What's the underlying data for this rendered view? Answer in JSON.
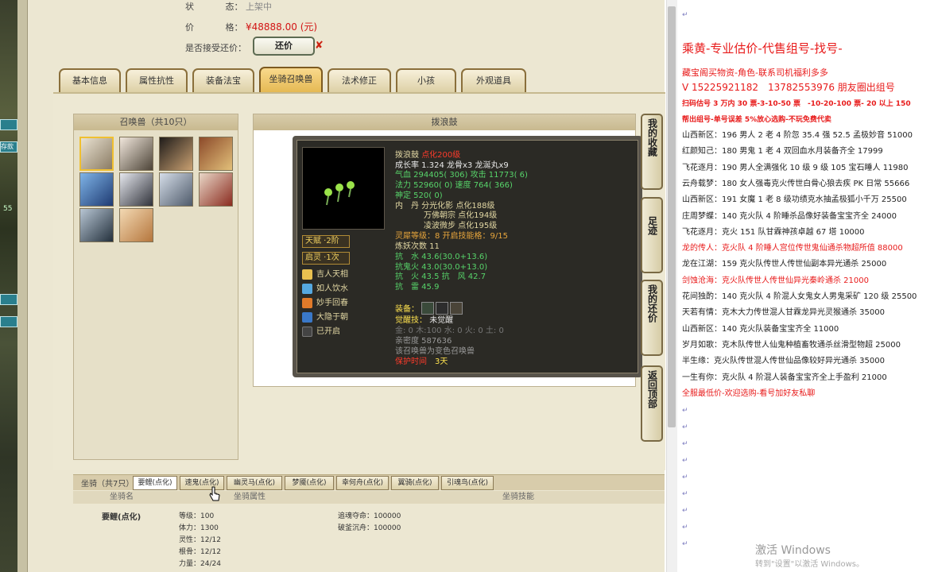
{
  "top": {
    "state_label": "状",
    "state_sep": "态：",
    "state_value": "上架中",
    "price_label": "价",
    "price_sep": "格：",
    "price_value": "¥48888.00 (元)",
    "haggle_label": "是否接受还价：",
    "haggle_button": "还价",
    "haggle_mark": "✘"
  },
  "tabs": [
    "基本信息",
    "属性抗性",
    "装备法宝",
    "坐骑召唤兽",
    "法术修正",
    "小孩",
    "外观道具"
  ],
  "summon_panel": {
    "title": "召唤兽（共10只）"
  },
  "detail": {
    "panel_title": "拨浪鼓",
    "name": "拨浪鼓",
    "name_tag": "点化200级",
    "growth": "成长率 1.324 龙骨x3 龙涎丸x9",
    "hp": "气血 294405( 306) 攻击 11773( 6)",
    "mp": "法力 52960( 0) 速度 764( 366)",
    "def": "神定 520( 0)",
    "inner1": "内　丹 分光化影 点化188级",
    "inner2": "万佛朝宗 点化194级",
    "inner3": "凌波微步 点化195级",
    "spirit": "灵犀等级：8 开启技能格：9/15",
    "refine": "炼妖次数 11",
    "res1": "抗　水 43.6(30.0+13.6)",
    "res2": "抗鬼火 43.0(30.0+13.0)",
    "res3": "抗　火 43.5 抗　风 42.7",
    "res4": "抗　雷 45.9",
    "talent": "天赋 ·2阶",
    "awaken": "启灵 ·1次",
    "skills": [
      "吉人天相",
      "如人饮水",
      "妙手回春",
      "大隐于朝",
      "已开启"
    ],
    "equip": "装备：",
    "awake_skill": "觉醒技：",
    "awake_value": "未觉醒",
    "elements": "金: 0 木:100 水: 0 火: 0 土: 0",
    "intimacy": "亲密度 587636",
    "transform": "该召唤兽为变色召唤兽",
    "protect": "保护时间",
    "protect_value": "3天"
  },
  "side_buttons": [
    "我的收藏",
    "足迹",
    "我的还价",
    "返回顶部"
  ],
  "mount": {
    "bar_label": "坐骑（共7只）",
    "tabs": [
      "要鲤(点化)",
      "速鬼(点化)",
      "幽灵马(点化)",
      "梦魇(点化)",
      "幸何舟(点化)",
      "翼骑(点化)",
      "引魂鸟(点化)"
    ],
    "headers": [
      "坐骑名",
      "坐骑属性",
      "坐骑技能"
    ],
    "name": "要鲤(点化)",
    "attrs": [
      "等级：100",
      "体力：1300",
      "灵性：12/12",
      "根骨：12/12",
      "力量：24/24"
    ],
    "skills": [
      "追魂夺命：100000",
      "破釜沉舟：100000"
    ]
  },
  "right": {
    "title": "乘黄-专业估价-代售组号-找号-",
    "l1": "藏宝阁买物资-角色-联系司机福利多多",
    "l2": "V 15225921182　13782553976 朋友圈出组号",
    "l3": "扫码估号 3 万内 30 票-3-10-50 票　-10-20-100 票- 20 以上 150",
    "l4": "帮出组号-单号误差 5%放心选购-不玩免费代卖",
    "items": [
      {
        "t": "山西新区：196 男人 2 老 4 阶忽 35.4 强 52.5 孟极妙音 51000",
        "c": "n"
      },
      {
        "t": "红颜知己：180 男鬼 1 老 4 双回血水月装备齐全 17999",
        "c": "n"
      },
      {
        "t": "飞花逐月：190 男人全满强化 10 级 9 级 105 宝石睡人 11980",
        "c": "n"
      },
      {
        "t": "云舟载梦：180 女人强毒克火传世白骨心狼去疾 PK 日常 55666",
        "c": "n"
      },
      {
        "t": "山西新区：191 女魔 1 老 8 级功绩克水抽孟极狐小千万 25500",
        "c": "n"
      },
      {
        "t": "庄周梦蝶：140 克火队 4 阶睡杀品像好装备宝宝齐全 24000",
        "c": "n"
      },
      {
        "t": "飞花逐月：克火 151 队甘霖神孩卓越 67 塔 10000",
        "c": "n"
      },
      {
        "t": "龙的传人：克火队 4 阶睡人宫位传世鬼仙通杀物超所值 88000",
        "c": "r"
      },
      {
        "t": "龙在江湖：159 克火队传世人传世仙副本异光通杀 25000",
        "c": "n"
      },
      {
        "t": "剑蚀沧海：克火队传世人传世仙异光秦岭通杀 21000",
        "c": "r"
      },
      {
        "t": "花间独酌：140 克火队 4 阶混人女鬼女人男鬼采矿 120 级 25500",
        "c": "n"
      },
      {
        "t": "天若有情：克木大力传世混人甘霖龙异光灵猴通杀 35000",
        "c": "n"
      },
      {
        "t": "山西新区：140 克火队装备宝宝齐全 11000",
        "c": "n"
      },
      {
        "t": "岁月如歌：克木队传世人仙鬼种植畜牧通杀丝滑型物超 25000",
        "c": "n"
      },
      {
        "t": "半生缘：克火队传世混人传世仙品像较好异光通杀 35000",
        "c": "n"
      },
      {
        "t": "一生有你：克火队 4 阶混人装备宝宝齐全上手盈利 21000",
        "c": "n"
      },
      {
        "t": "全服最低价-欢迎选购-看号加好友私聊",
        "c": "r"
      }
    ],
    "watermark": "激活 Windows",
    "watermark2": "转到\"设置\"以激活 Windows。"
  },
  "left_stub": [
    "55",
    "存款"
  ]
}
